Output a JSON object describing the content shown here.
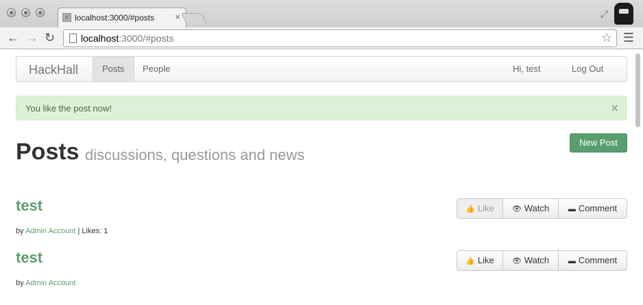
{
  "browser": {
    "tab_title": "localhost:3000/#posts",
    "tab_close": "×",
    "url_host": "localhost",
    "url_rest": ":3000/#posts"
  },
  "icons": {
    "back": "arrow-left-icon",
    "forward": "arrow-right-icon",
    "reload": "reload-icon",
    "star": "star-icon",
    "menu": "hamburger-menu-icon",
    "like": "thumbs-up-icon",
    "watch": "eye-icon",
    "comment": "speech-bubble-icon"
  },
  "navbar": {
    "brand": "HackHall",
    "links": [
      {
        "label": "Posts",
        "active": true
      },
      {
        "label": "People",
        "active": false
      }
    ],
    "greeting": "Hi, test",
    "logout": "Log Out"
  },
  "alert": {
    "message": "You like the post now!",
    "close": "×"
  },
  "header": {
    "title": "Posts",
    "subtitle": "discussions, questions and news",
    "new_post_label": "New Post"
  },
  "posts": [
    {
      "title": "test",
      "by": "by",
      "author": "Admin Account",
      "likes_text": " | Likes: 1",
      "actions": {
        "like": "Like",
        "watch": "Watch",
        "comment": "Comment"
      },
      "like_disabled": true
    },
    {
      "title": "test",
      "by": "by",
      "author": "Admin Account",
      "likes_text": "",
      "actions": {
        "like": "Like",
        "watch": "Watch",
        "comment": "Comment"
      },
      "like_disabled": false
    }
  ],
  "colors": {
    "brand_green": "#5c9c6f",
    "alert_bg": "#dff0d8",
    "button_green": "#5a9e6f"
  }
}
